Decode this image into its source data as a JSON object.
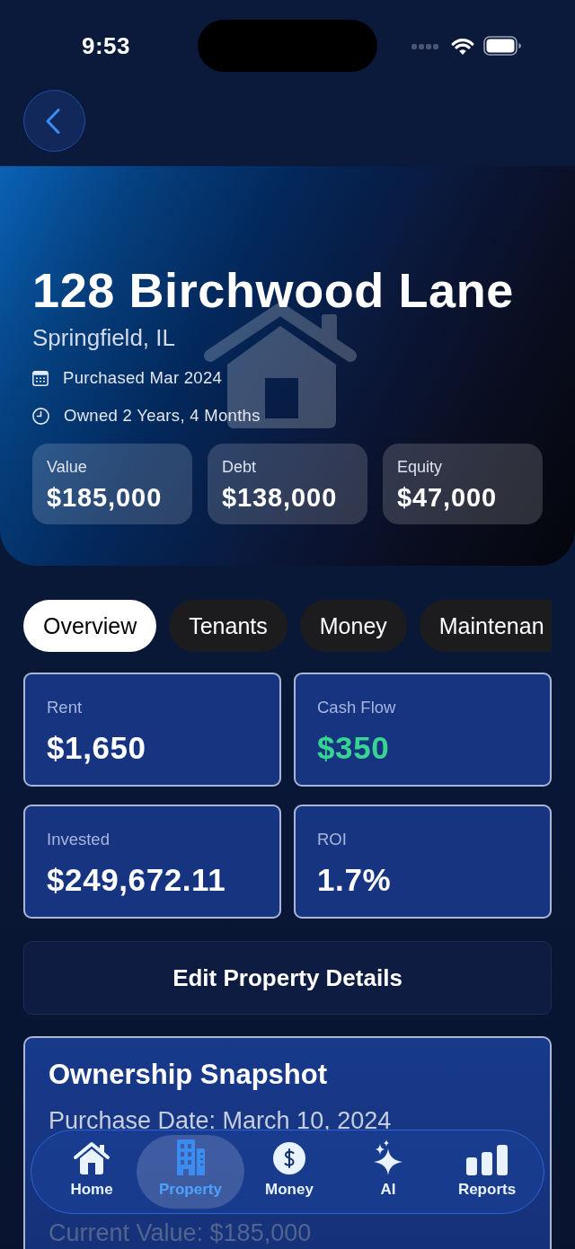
{
  "status_bar": {
    "time": "9:53"
  },
  "property": {
    "title": "128 Birchwood Lane",
    "location": "Springfield, IL",
    "details": [
      "Purchased Mar 2024",
      "Owned 2 Years, 4 Months"
    ],
    "stats": [
      {
        "label": "Value",
        "value": "$185,000"
      },
      {
        "label": "Debt",
        "value": "$138,000"
      },
      {
        "label": "Equity",
        "value": "$47,000"
      }
    ]
  },
  "tabs": [
    {
      "label": "Overview",
      "selected": true
    },
    {
      "label": "Tenants",
      "selected": false
    },
    {
      "label": "Money",
      "selected": false
    },
    {
      "label": "Maintenan",
      "selected": false
    }
  ],
  "metrics": [
    {
      "label": "Rent",
      "value": "$1,650",
      "color": "#ffffff"
    },
    {
      "label": "Cash Flow",
      "value": "$350",
      "color": "#38d493"
    },
    {
      "label": "Invested",
      "value": "$249,672.11",
      "color": "#ffffff"
    },
    {
      "label": "ROI",
      "value": "1.7%",
      "color": "#ffffff"
    }
  ],
  "edit_button": {
    "label": "Edit Property Details"
  },
  "snapshot": {
    "title": "Ownership Snapshot",
    "rows": [
      "Purchase Date: March 10, 2024",
      "Current Value: $185,000"
    ]
  },
  "tab_bar": [
    {
      "label": "Home",
      "selected": false
    },
    {
      "label": "Property",
      "selected": true
    },
    {
      "label": "Money",
      "selected": false
    },
    {
      "label": "AI",
      "selected": false
    },
    {
      "label": "Reports",
      "selected": false
    }
  ]
}
